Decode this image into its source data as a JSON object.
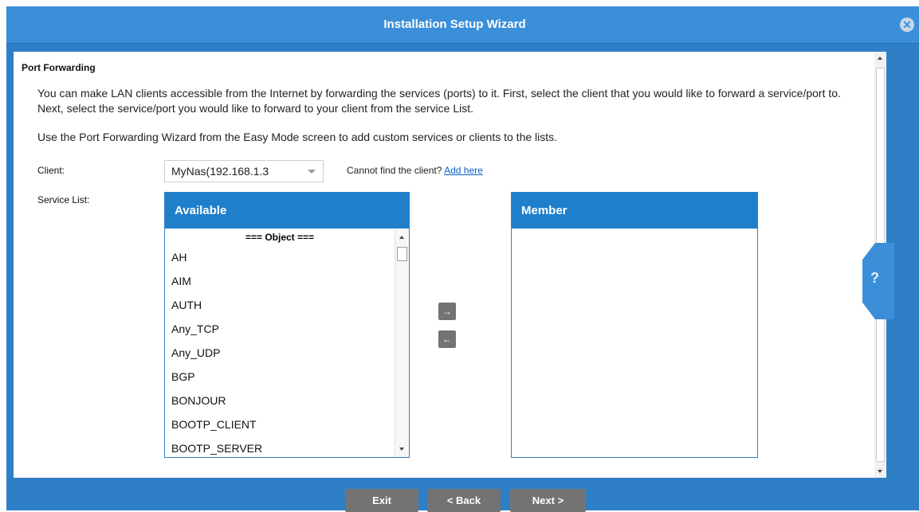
{
  "window": {
    "title": "Installation Setup Wizard"
  },
  "section": {
    "title": "Port Forwarding",
    "description": "You can make LAN clients accessible from the Internet by forwarding the services (ports) to it. First, select the client that you would like to forward a service/port to. Next, select the service/port you would like to forward to your client from the service List.",
    "note": "Use the Port Forwarding Wizard from the Easy Mode screen to add custom services or clients to the lists."
  },
  "client": {
    "label": "Client:",
    "value": "MyNas(192.168.1.3",
    "cannot_find": "Cannot find the client?",
    "add_link": "Add here"
  },
  "service_list": {
    "label": "Service List:",
    "available_title": "Available",
    "member_title": "Member",
    "object_header": "=== Object ===",
    "items": [
      "AH",
      "AIM",
      "AUTH",
      "Any_TCP",
      "Any_UDP",
      "BGP",
      "BONJOUR",
      "BOOTP_CLIENT",
      "BOOTP_SERVER"
    ]
  },
  "arrows": {
    "add": "→",
    "remove": "←"
  },
  "footer": {
    "exit": "Exit",
    "back": "< Back",
    "next": "Next >"
  },
  "icons": {
    "close": "close-icon",
    "help": "help-icon"
  },
  "colors": {
    "accent": "#3b8fd9",
    "header": "#1f7fcb",
    "button": "#737373"
  }
}
